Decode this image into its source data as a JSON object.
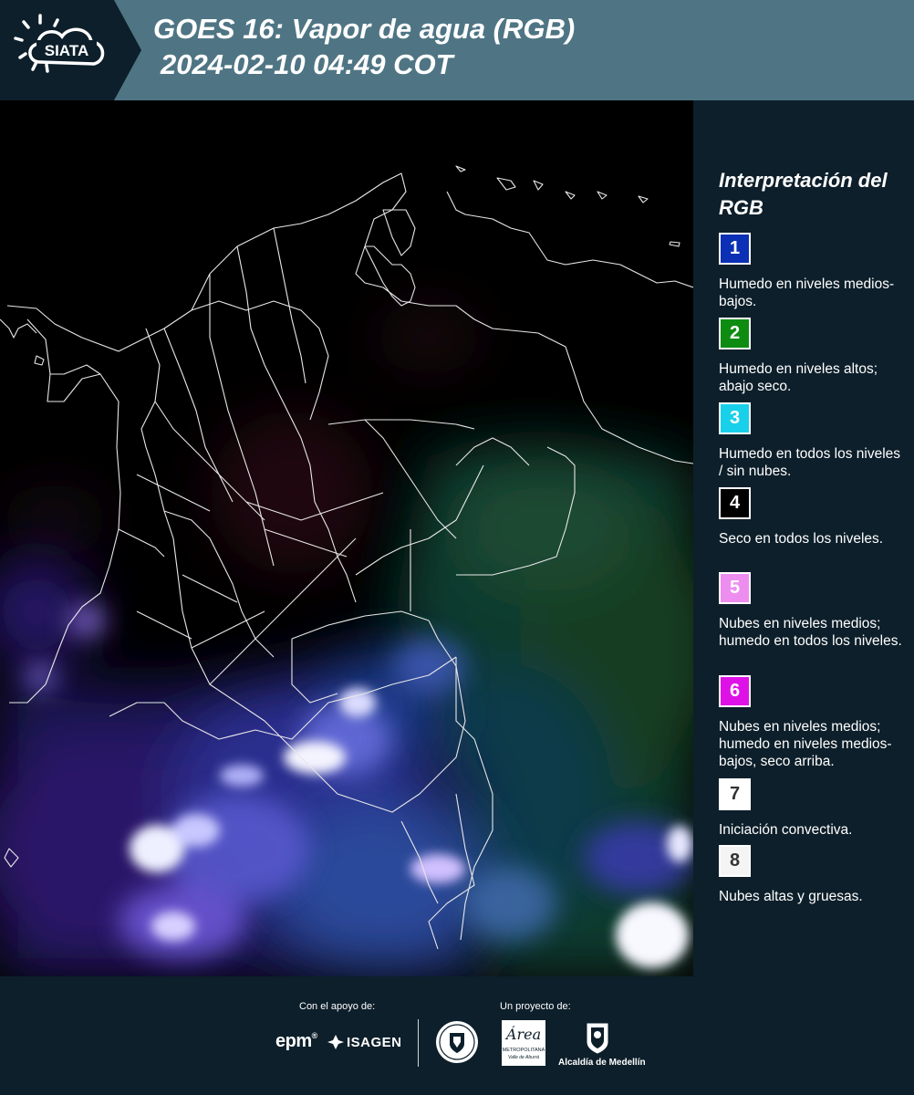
{
  "header": {
    "logo_text": "SIATA",
    "title_line1": "GOES 16: Vapor de agua (RGB)",
    "title_line2": "2024-02-10 04:49 COT"
  },
  "map": {
    "icon": "satellite-water-vapor-map"
  },
  "legend": {
    "title": "Interpretación del RGB",
    "items": [
      {
        "number": "1",
        "color": "#0b2fb5",
        "text_color": "#ffffff",
        "text": "Humedo en niveles medios-bajos."
      },
      {
        "number": "2",
        "color": "#0e8c12",
        "text_color": "#ffffff",
        "text": "Humedo en niveles altos; abajo seco."
      },
      {
        "number": "3",
        "color": "#19d0ea",
        "text_color": "#ffffff",
        "text": "Humedo en todos los niveles / sin nubes."
      },
      {
        "number": "4",
        "color": "#000000",
        "text_color": "#ffffff",
        "text": "Seco en todos los niveles."
      },
      {
        "number": "5",
        "color": "#ee8df0",
        "text_color": "#ffffff",
        "text": "Nubes en niveles medios; humedo en todos los niveles."
      },
      {
        "number": "6",
        "color": "#de12e6",
        "text_color": "#ffffff",
        "text": "Nubes en niveles medios; humedo en niveles medios-bajos, seco arriba."
      },
      {
        "number": "7",
        "color": "#ffffff",
        "text_color": "#333333",
        "text": "Iniciación convectiva."
      },
      {
        "number": "8",
        "color": "#f4f4f4",
        "text_color": "#333333",
        "text": "Nubes altas y gruesas."
      }
    ]
  },
  "footer": {
    "support_label": "Con el apoyo de:",
    "project_label": "Un proyecto de:",
    "epm": "epm",
    "isagen": "ISAGEN",
    "area_script": "Área",
    "area_name": "METROPOLITANA",
    "area_sub": "Valle de Aburrá",
    "alcaldia": "Alcaldía de Medellín"
  }
}
